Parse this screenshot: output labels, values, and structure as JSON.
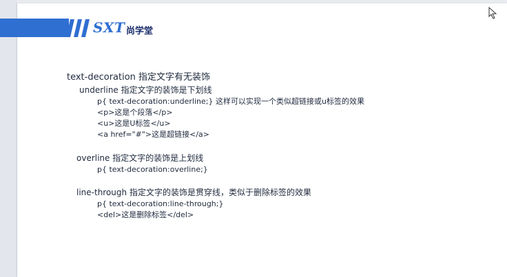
{
  "logo": {
    "brand": "SXT",
    "name": "尚学堂"
  },
  "lines": [
    "text-decoration 指定文字有无装饰",
    "underline  指定文字的装饰是下划线",
    "p{ text-decoration:underline;}  这样可以实现一个类似超链接或u标签的效果",
    "<p>这是个段落</p>",
    "<u>这是U标签</u>",
    "<a href=\"#\">这是超链接</a>",
    "overline  指定文字的装饰是上划线",
    "p{ text-decoration:overline;}",
    "line-through 指定文字的装饰是贯穿线，类似于删除标签的效果",
    "p{ text-decoration:line-through;}",
    "<del>这是删除标签</del>"
  ],
  "colors": {
    "accent": "#2f6fd1",
    "text": "#1f2a3d",
    "brand_dark": "#1a2c6b"
  }
}
